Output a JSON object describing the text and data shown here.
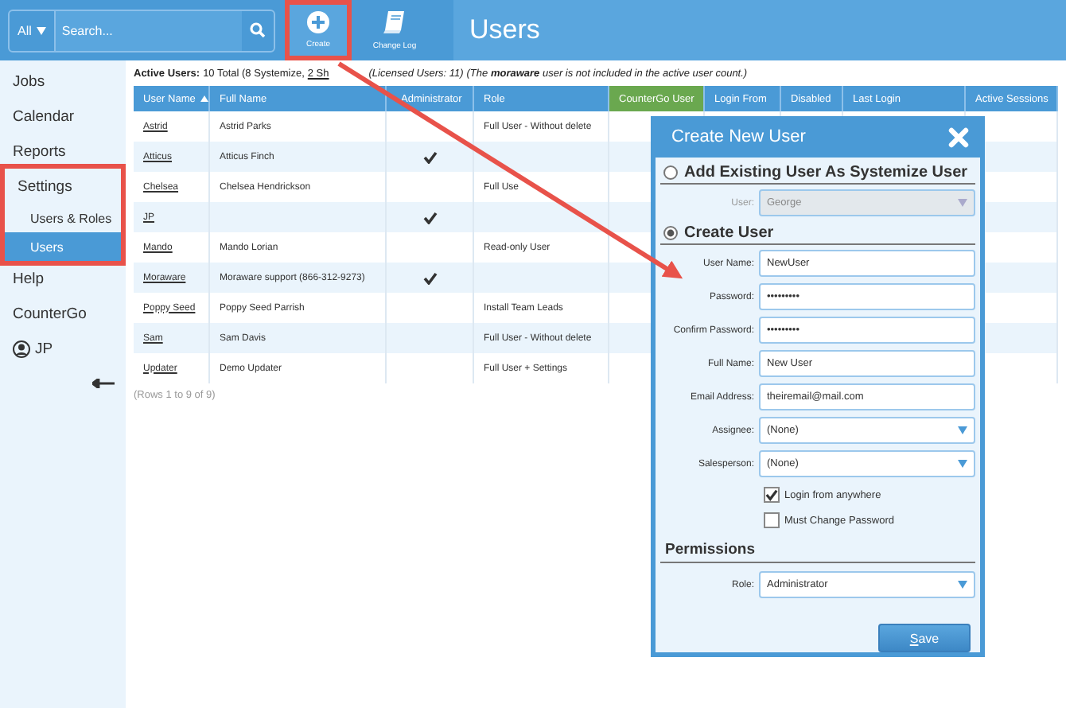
{
  "search": {
    "scope": "All",
    "placeholder": "Search..."
  },
  "toolbar": [
    {
      "label": "Create",
      "highlighted": true
    },
    {
      "label": "Change Log",
      "highlighted": false
    }
  ],
  "page_title": "Users",
  "sidebar": {
    "items": [
      {
        "label": "Jobs",
        "kind": "item",
        "highlighted": false
      },
      {
        "label": "Calendar",
        "kind": "item",
        "highlighted": false
      },
      {
        "label": "Reports",
        "kind": "item",
        "highlighted": false
      },
      {
        "label": "Settings",
        "kind": "item",
        "highlighted": true,
        "children": [
          {
            "label": "Users & Roles",
            "selected": false
          },
          {
            "label": "Users",
            "selected": true
          }
        ]
      },
      {
        "label": "Help",
        "kind": "item",
        "highlighted": false
      },
      {
        "label": "CounterGo",
        "kind": "item",
        "highlighted": false
      },
      {
        "label": "JP",
        "kind": "user",
        "highlighted": false
      }
    ]
  },
  "summary": {
    "label": "Active Users:",
    "total": "10 Total (8 Systemize,",
    "link": "2 Sh",
    "licensed": "(Licensed Users: 11)",
    "note": "(The **moraware** user is not included in the active user count.)"
  },
  "table": {
    "columns": [
      {
        "label": "User Name",
        "sorted": true,
        "highlighted": false
      },
      {
        "label": "Full Name",
        "sorted": false,
        "highlighted": false
      },
      {
        "label": "Administrator",
        "sorted": false,
        "highlighted": false
      },
      {
        "label": "Role",
        "sorted": false,
        "highlighted": false
      },
      {
        "label": "CounterGo User",
        "sorted": false,
        "highlighted": true
      },
      {
        "label": "Login From",
        "sorted": false,
        "highlighted": false
      },
      {
        "label": "Disabled",
        "sorted": false,
        "highlighted": false
      },
      {
        "label": "Last Login",
        "sorted": false,
        "highlighted": false
      },
      {
        "label": "Active Sessions",
        "sorted": false,
        "highlighted": false
      }
    ],
    "rows": [
      {
        "user": "Astrid",
        "full_name": "Astrid Parks",
        "admin": false,
        "role": "Full User - Without delete"
      },
      {
        "user": "Atticus",
        "full_name": "Atticus Finch",
        "admin": true,
        "role": ""
      },
      {
        "user": "Chelsea",
        "full_name": "Chelsea Hendrickson",
        "admin": false,
        "role": "Full Use"
      },
      {
        "user": "JP",
        "full_name": "",
        "admin": true,
        "role": ""
      },
      {
        "user": "Mando",
        "full_name": "Mando Lorian",
        "admin": false,
        "role": "Read-only User"
      },
      {
        "user": "Moraware",
        "full_name": "Moraware support (866-312-9273)",
        "admin": true,
        "role": ""
      },
      {
        "user": "Poppy Seed",
        "full_name": "Poppy Seed Parrish",
        "admin": false,
        "role": "Install Team Leads"
      },
      {
        "user": "Sam",
        "full_name": "Sam Davis",
        "admin": false,
        "role": "Full User - Without delete"
      },
      {
        "user": "Updater",
        "full_name": "Demo Updater",
        "admin": false,
        "role": "Full User + Settings"
      }
    ],
    "footer": "(Rows 1 to 9 of 9)"
  },
  "dialog": {
    "title": "Create New User",
    "options": [
      {
        "label": "Add Existing User As Systemize User",
        "selected": false,
        "fields": [
          {
            "label": "User:",
            "value": "George",
            "kind": "select",
            "disabled": true
          }
        ]
      },
      {
        "label": "Create User",
        "selected": true,
        "fields": [
          {
            "label": "User Name:",
            "value": "NewUser",
            "kind": "text",
            "disabled": false
          },
          {
            "label": "Password:",
            "value": "•••••••••",
            "kind": "text",
            "disabled": false
          },
          {
            "label": "Confirm Password:",
            "value": "•••••••••",
            "kind": "text",
            "disabled": false
          },
          {
            "label": "Full Name:",
            "value": "New User",
            "kind": "text",
            "disabled": false
          },
          {
            "label": "Email Address:",
            "value": "theiremail@mail.com",
            "kind": "text",
            "disabled": false
          },
          {
            "label": "Assignee:",
            "value": "(None)",
            "kind": "select",
            "disabled": false
          },
          {
            "label": "Salesperson:",
            "value": "(None)",
            "kind": "select",
            "disabled": false
          }
        ]
      }
    ],
    "checkboxes": [
      {
        "label": "Login from anywhere",
        "checked": true
      },
      {
        "label": "Must Change Password",
        "checked": false
      }
    ],
    "permissions": {
      "heading": "Permissions",
      "fields": [
        {
          "label": "Role:",
          "value": "Administrator",
          "kind": "select",
          "disabled": false
        }
      ]
    },
    "save": "Save"
  }
}
